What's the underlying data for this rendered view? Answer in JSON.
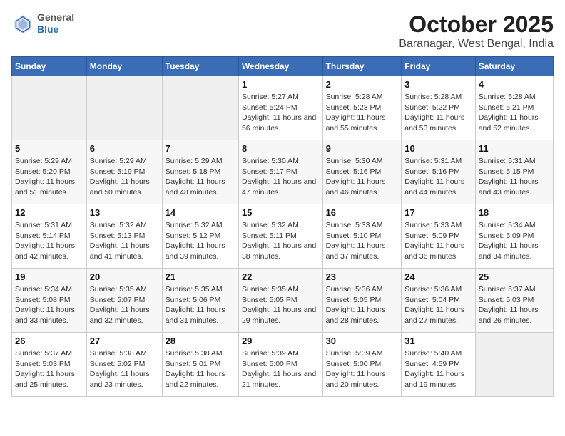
{
  "logo": {
    "general": "General",
    "blue": "Blue"
  },
  "title": "October 2025",
  "subtitle": "Baranagar, West Bengal, India",
  "days_of_week": [
    "Sunday",
    "Monday",
    "Tuesday",
    "Wednesday",
    "Thursday",
    "Friday",
    "Saturday"
  ],
  "weeks": [
    [
      {
        "day": "",
        "sunrise": "",
        "sunset": "",
        "daylight": ""
      },
      {
        "day": "",
        "sunrise": "",
        "sunset": "",
        "daylight": ""
      },
      {
        "day": "",
        "sunrise": "",
        "sunset": "",
        "daylight": ""
      },
      {
        "day": "1",
        "sunrise": "Sunrise: 5:27 AM",
        "sunset": "Sunset: 5:24 PM",
        "daylight": "Daylight: 11 hours and 56 minutes."
      },
      {
        "day": "2",
        "sunrise": "Sunrise: 5:28 AM",
        "sunset": "Sunset: 5:23 PM",
        "daylight": "Daylight: 11 hours and 55 minutes."
      },
      {
        "day": "3",
        "sunrise": "Sunrise: 5:28 AM",
        "sunset": "Sunset: 5:22 PM",
        "daylight": "Daylight: 11 hours and 53 minutes."
      },
      {
        "day": "4",
        "sunrise": "Sunrise: 5:28 AM",
        "sunset": "Sunset: 5:21 PM",
        "daylight": "Daylight: 11 hours and 52 minutes."
      }
    ],
    [
      {
        "day": "5",
        "sunrise": "Sunrise: 5:29 AM",
        "sunset": "Sunset: 5:20 PM",
        "daylight": "Daylight: 11 hours and 51 minutes."
      },
      {
        "day": "6",
        "sunrise": "Sunrise: 5:29 AM",
        "sunset": "Sunset: 5:19 PM",
        "daylight": "Daylight: 11 hours and 50 minutes."
      },
      {
        "day": "7",
        "sunrise": "Sunrise: 5:29 AM",
        "sunset": "Sunset: 5:18 PM",
        "daylight": "Daylight: 11 hours and 48 minutes."
      },
      {
        "day": "8",
        "sunrise": "Sunrise: 5:30 AM",
        "sunset": "Sunset: 5:17 PM",
        "daylight": "Daylight: 11 hours and 47 minutes."
      },
      {
        "day": "9",
        "sunrise": "Sunrise: 5:30 AM",
        "sunset": "Sunset: 5:16 PM",
        "daylight": "Daylight: 11 hours and 46 minutes."
      },
      {
        "day": "10",
        "sunrise": "Sunrise: 5:31 AM",
        "sunset": "Sunset: 5:16 PM",
        "daylight": "Daylight: 11 hours and 44 minutes."
      },
      {
        "day": "11",
        "sunrise": "Sunrise: 5:31 AM",
        "sunset": "Sunset: 5:15 PM",
        "daylight": "Daylight: 11 hours and 43 minutes."
      }
    ],
    [
      {
        "day": "12",
        "sunrise": "Sunrise: 5:31 AM",
        "sunset": "Sunset: 5:14 PM",
        "daylight": "Daylight: 11 hours and 42 minutes."
      },
      {
        "day": "13",
        "sunrise": "Sunrise: 5:32 AM",
        "sunset": "Sunset: 5:13 PM",
        "daylight": "Daylight: 11 hours and 41 minutes."
      },
      {
        "day": "14",
        "sunrise": "Sunrise: 5:32 AM",
        "sunset": "Sunset: 5:12 PM",
        "daylight": "Daylight: 11 hours and 39 minutes."
      },
      {
        "day": "15",
        "sunrise": "Sunrise: 5:32 AM",
        "sunset": "Sunset: 5:11 PM",
        "daylight": "Daylight: 11 hours and 38 minutes."
      },
      {
        "day": "16",
        "sunrise": "Sunrise: 5:33 AM",
        "sunset": "Sunset: 5:10 PM",
        "daylight": "Daylight: 11 hours and 37 minutes."
      },
      {
        "day": "17",
        "sunrise": "Sunrise: 5:33 AM",
        "sunset": "Sunset: 5:09 PM",
        "daylight": "Daylight: 11 hours and 36 minutes."
      },
      {
        "day": "18",
        "sunrise": "Sunrise: 5:34 AM",
        "sunset": "Sunset: 5:09 PM",
        "daylight": "Daylight: 11 hours and 34 minutes."
      }
    ],
    [
      {
        "day": "19",
        "sunrise": "Sunrise: 5:34 AM",
        "sunset": "Sunset: 5:08 PM",
        "daylight": "Daylight: 11 hours and 33 minutes."
      },
      {
        "day": "20",
        "sunrise": "Sunrise: 5:35 AM",
        "sunset": "Sunset: 5:07 PM",
        "daylight": "Daylight: 11 hours and 32 minutes."
      },
      {
        "day": "21",
        "sunrise": "Sunrise: 5:35 AM",
        "sunset": "Sunset: 5:06 PM",
        "daylight": "Daylight: 11 hours and 31 minutes."
      },
      {
        "day": "22",
        "sunrise": "Sunrise: 5:35 AM",
        "sunset": "Sunset: 5:05 PM",
        "daylight": "Daylight: 11 hours and 29 minutes."
      },
      {
        "day": "23",
        "sunrise": "Sunrise: 5:36 AM",
        "sunset": "Sunset: 5:05 PM",
        "daylight": "Daylight: 11 hours and 28 minutes."
      },
      {
        "day": "24",
        "sunrise": "Sunrise: 5:36 AM",
        "sunset": "Sunset: 5:04 PM",
        "daylight": "Daylight: 11 hours and 27 minutes."
      },
      {
        "day": "25",
        "sunrise": "Sunrise: 5:37 AM",
        "sunset": "Sunset: 5:03 PM",
        "daylight": "Daylight: 11 hours and 26 minutes."
      }
    ],
    [
      {
        "day": "26",
        "sunrise": "Sunrise: 5:37 AM",
        "sunset": "Sunset: 5:03 PM",
        "daylight": "Daylight: 11 hours and 25 minutes."
      },
      {
        "day": "27",
        "sunrise": "Sunrise: 5:38 AM",
        "sunset": "Sunset: 5:02 PM",
        "daylight": "Daylight: 11 hours and 23 minutes."
      },
      {
        "day": "28",
        "sunrise": "Sunrise: 5:38 AM",
        "sunset": "Sunset: 5:01 PM",
        "daylight": "Daylight: 11 hours and 22 minutes."
      },
      {
        "day": "29",
        "sunrise": "Sunrise: 5:39 AM",
        "sunset": "Sunset: 5:00 PM",
        "daylight": "Daylight: 11 hours and 21 minutes."
      },
      {
        "day": "30",
        "sunrise": "Sunrise: 5:39 AM",
        "sunset": "Sunset: 5:00 PM",
        "daylight": "Daylight: 11 hours and 20 minutes."
      },
      {
        "day": "31",
        "sunrise": "Sunrise: 5:40 AM",
        "sunset": "Sunset: 4:59 PM",
        "daylight": "Daylight: 11 hours and 19 minutes."
      },
      {
        "day": "",
        "sunrise": "",
        "sunset": "",
        "daylight": ""
      }
    ]
  ]
}
